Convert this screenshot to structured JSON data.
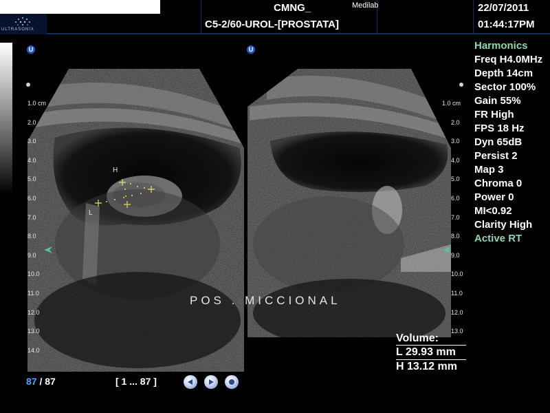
{
  "header": {
    "brand": "ULTRASONIX",
    "patient_name": "CMNG_",
    "institution": "Medilab",
    "preset": "C5-2/60-UROL-[PROSTATA]",
    "date": "22/07/2011",
    "time": "01:44:17PM"
  },
  "icons": {
    "orientation": "u-orientation-icon",
    "focus": "focus-arrow-icon",
    "play_back": "rewind-icon",
    "play_forward": "play-icon",
    "stop": "stop-icon"
  },
  "left_image": {
    "orientation_label": "U",
    "depth_marks": [
      "1.0 cm",
      "2.0",
      "3.0",
      "4.0",
      "5.0",
      "6.0",
      "7.0",
      "8.0",
      "9.0",
      "10.0",
      "11.0",
      "12.0",
      "13.0",
      "14.0"
    ],
    "caliper_h_label": "H",
    "caliper_l_label": "L"
  },
  "right_image": {
    "orientation_label": "U",
    "depth_marks": [
      "1.0 cm",
      "2.0",
      "3.0",
      "4.0",
      "5.0",
      "6.0",
      "7.0",
      "8.0",
      "9.0",
      "10.0",
      "11.0",
      "12.0",
      "13.0"
    ]
  },
  "caption": "POS .  MICCIONAL",
  "parameters": [
    {
      "text": "Harmonics",
      "accent": true
    },
    {
      "text": "Freq H4.0MHz",
      "accent": false
    },
    {
      "text": "Depth 14cm",
      "accent": false
    },
    {
      "text": "Sector 100%",
      "accent": false
    },
    {
      "text": "Gain 55%",
      "accent": false
    },
    {
      "text": "FR High",
      "accent": false
    },
    {
      "text": "FPS 18 Hz",
      "accent": false
    },
    {
      "text": "Dyn 65dB",
      "accent": false
    },
    {
      "text": "Persist 2",
      "accent": false
    },
    {
      "text": "Map 3",
      "accent": false
    },
    {
      "text": "Chroma 0",
      "accent": false
    },
    {
      "text": "Power 0",
      "accent": false
    },
    {
      "text": "MI<0.92",
      "accent": false
    },
    {
      "text": "Clarity High",
      "accent": false
    },
    {
      "text": "Active RT",
      "accent": true
    }
  ],
  "measurement": {
    "title": "Volume:",
    "length": "L 29.93 mm",
    "height": "H 13.12 mm"
  },
  "footer": {
    "current_frame": "87",
    "total_frames": " / 87",
    "frame_range": "[ 1 ... 87 ]"
  },
  "colors": {
    "accent_green": "#8fd6b6",
    "frame_blue": "#4fa6ff",
    "caliper_yellow": "#e6e35a"
  }
}
